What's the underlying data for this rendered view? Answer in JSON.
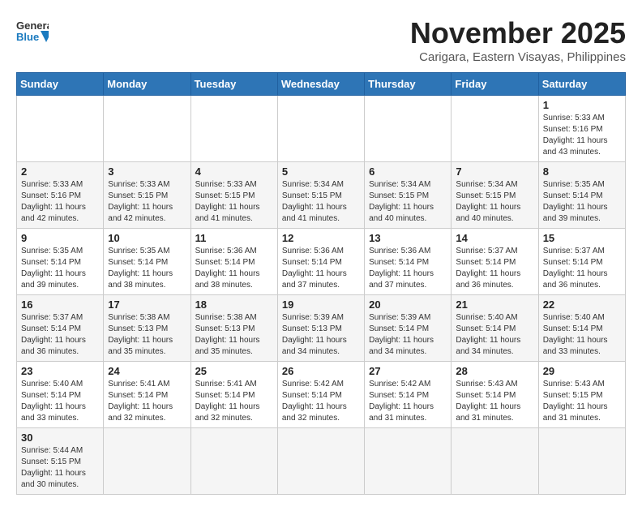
{
  "header": {
    "logo_general": "General",
    "logo_blue": "Blue",
    "title": "November 2025",
    "subtitle": "Carigara, Eastern Visayas, Philippines"
  },
  "weekdays": [
    "Sunday",
    "Monday",
    "Tuesday",
    "Wednesday",
    "Thursday",
    "Friday",
    "Saturday"
  ],
  "weeks": [
    [
      {
        "day": "",
        "info": ""
      },
      {
        "day": "",
        "info": ""
      },
      {
        "day": "",
        "info": ""
      },
      {
        "day": "",
        "info": ""
      },
      {
        "day": "",
        "info": ""
      },
      {
        "day": "",
        "info": ""
      },
      {
        "day": "1",
        "info": "Sunrise: 5:33 AM\nSunset: 5:16 PM\nDaylight: 11 hours and 43 minutes."
      }
    ],
    [
      {
        "day": "2",
        "info": "Sunrise: 5:33 AM\nSunset: 5:16 PM\nDaylight: 11 hours and 42 minutes."
      },
      {
        "day": "3",
        "info": "Sunrise: 5:33 AM\nSunset: 5:15 PM\nDaylight: 11 hours and 42 minutes."
      },
      {
        "day": "4",
        "info": "Sunrise: 5:33 AM\nSunset: 5:15 PM\nDaylight: 11 hours and 41 minutes."
      },
      {
        "day": "5",
        "info": "Sunrise: 5:34 AM\nSunset: 5:15 PM\nDaylight: 11 hours and 41 minutes."
      },
      {
        "day": "6",
        "info": "Sunrise: 5:34 AM\nSunset: 5:15 PM\nDaylight: 11 hours and 40 minutes."
      },
      {
        "day": "7",
        "info": "Sunrise: 5:34 AM\nSunset: 5:15 PM\nDaylight: 11 hours and 40 minutes."
      },
      {
        "day": "8",
        "info": "Sunrise: 5:35 AM\nSunset: 5:14 PM\nDaylight: 11 hours and 39 minutes."
      }
    ],
    [
      {
        "day": "9",
        "info": "Sunrise: 5:35 AM\nSunset: 5:14 PM\nDaylight: 11 hours and 39 minutes."
      },
      {
        "day": "10",
        "info": "Sunrise: 5:35 AM\nSunset: 5:14 PM\nDaylight: 11 hours and 38 minutes."
      },
      {
        "day": "11",
        "info": "Sunrise: 5:36 AM\nSunset: 5:14 PM\nDaylight: 11 hours and 38 minutes."
      },
      {
        "day": "12",
        "info": "Sunrise: 5:36 AM\nSunset: 5:14 PM\nDaylight: 11 hours and 37 minutes."
      },
      {
        "day": "13",
        "info": "Sunrise: 5:36 AM\nSunset: 5:14 PM\nDaylight: 11 hours and 37 minutes."
      },
      {
        "day": "14",
        "info": "Sunrise: 5:37 AM\nSunset: 5:14 PM\nDaylight: 11 hours and 36 minutes."
      },
      {
        "day": "15",
        "info": "Sunrise: 5:37 AM\nSunset: 5:14 PM\nDaylight: 11 hours and 36 minutes."
      }
    ],
    [
      {
        "day": "16",
        "info": "Sunrise: 5:37 AM\nSunset: 5:14 PM\nDaylight: 11 hours and 36 minutes."
      },
      {
        "day": "17",
        "info": "Sunrise: 5:38 AM\nSunset: 5:13 PM\nDaylight: 11 hours and 35 minutes."
      },
      {
        "day": "18",
        "info": "Sunrise: 5:38 AM\nSunset: 5:13 PM\nDaylight: 11 hours and 35 minutes."
      },
      {
        "day": "19",
        "info": "Sunrise: 5:39 AM\nSunset: 5:13 PM\nDaylight: 11 hours and 34 minutes."
      },
      {
        "day": "20",
        "info": "Sunrise: 5:39 AM\nSunset: 5:14 PM\nDaylight: 11 hours and 34 minutes."
      },
      {
        "day": "21",
        "info": "Sunrise: 5:40 AM\nSunset: 5:14 PM\nDaylight: 11 hours and 34 minutes."
      },
      {
        "day": "22",
        "info": "Sunrise: 5:40 AM\nSunset: 5:14 PM\nDaylight: 11 hours and 33 minutes."
      }
    ],
    [
      {
        "day": "23",
        "info": "Sunrise: 5:40 AM\nSunset: 5:14 PM\nDaylight: 11 hours and 33 minutes."
      },
      {
        "day": "24",
        "info": "Sunrise: 5:41 AM\nSunset: 5:14 PM\nDaylight: 11 hours and 32 minutes."
      },
      {
        "day": "25",
        "info": "Sunrise: 5:41 AM\nSunset: 5:14 PM\nDaylight: 11 hours and 32 minutes."
      },
      {
        "day": "26",
        "info": "Sunrise: 5:42 AM\nSunset: 5:14 PM\nDaylight: 11 hours and 32 minutes."
      },
      {
        "day": "27",
        "info": "Sunrise: 5:42 AM\nSunset: 5:14 PM\nDaylight: 11 hours and 31 minutes."
      },
      {
        "day": "28",
        "info": "Sunrise: 5:43 AM\nSunset: 5:14 PM\nDaylight: 11 hours and 31 minutes."
      },
      {
        "day": "29",
        "info": "Sunrise: 5:43 AM\nSunset: 5:15 PM\nDaylight: 11 hours and 31 minutes."
      }
    ],
    [
      {
        "day": "30",
        "info": "Sunrise: 5:44 AM\nSunset: 5:15 PM\nDaylight: 11 hours and 30 minutes."
      },
      {
        "day": "",
        "info": ""
      },
      {
        "day": "",
        "info": ""
      },
      {
        "day": "",
        "info": ""
      },
      {
        "day": "",
        "info": ""
      },
      {
        "day": "",
        "info": ""
      },
      {
        "day": "",
        "info": ""
      }
    ]
  ]
}
